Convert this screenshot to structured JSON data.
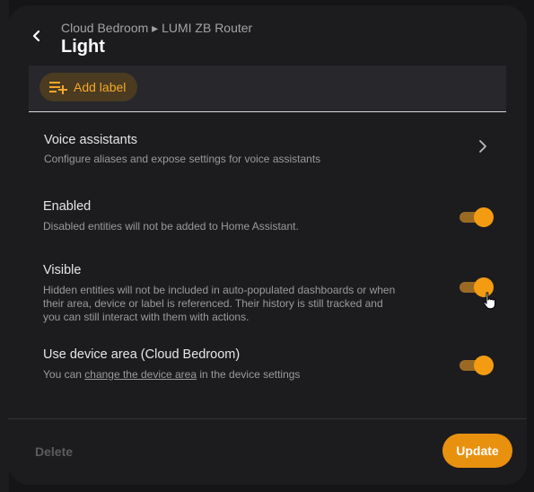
{
  "header": {
    "breadcrumb": "Cloud Bedroom ▸ LUMI ZB Router",
    "title": "Light"
  },
  "labels": {
    "add_label": "Add label"
  },
  "settings": {
    "voice": {
      "title": "Voice assistants",
      "description": "Configure aliases and expose settings for voice assistants"
    },
    "enabled": {
      "title": "Enabled",
      "description": "Disabled entities will not be added to Home Assistant.",
      "on": true
    },
    "visible": {
      "title": "Visible",
      "description_line1": "Hidden entities will not be included in auto-populated dashboards or when",
      "description_line2": "their area, device or label is referenced. Their history is still tracked and",
      "description_line3": "you can still interact with them with actions.",
      "on": true
    },
    "device_area": {
      "title": "Use device area (Cloud Bedroom)",
      "desc_prefix": "You can ",
      "desc_link": "change the device area",
      "desc_suffix": " in the device settings",
      "on": true
    }
  },
  "footer": {
    "delete": "Delete",
    "update": "Update"
  },
  "colors": {
    "accent": "#f39c12",
    "accent_track": "#9a6a24",
    "button": "#e8910f",
    "dialog_bg": "#1c1c1f"
  }
}
